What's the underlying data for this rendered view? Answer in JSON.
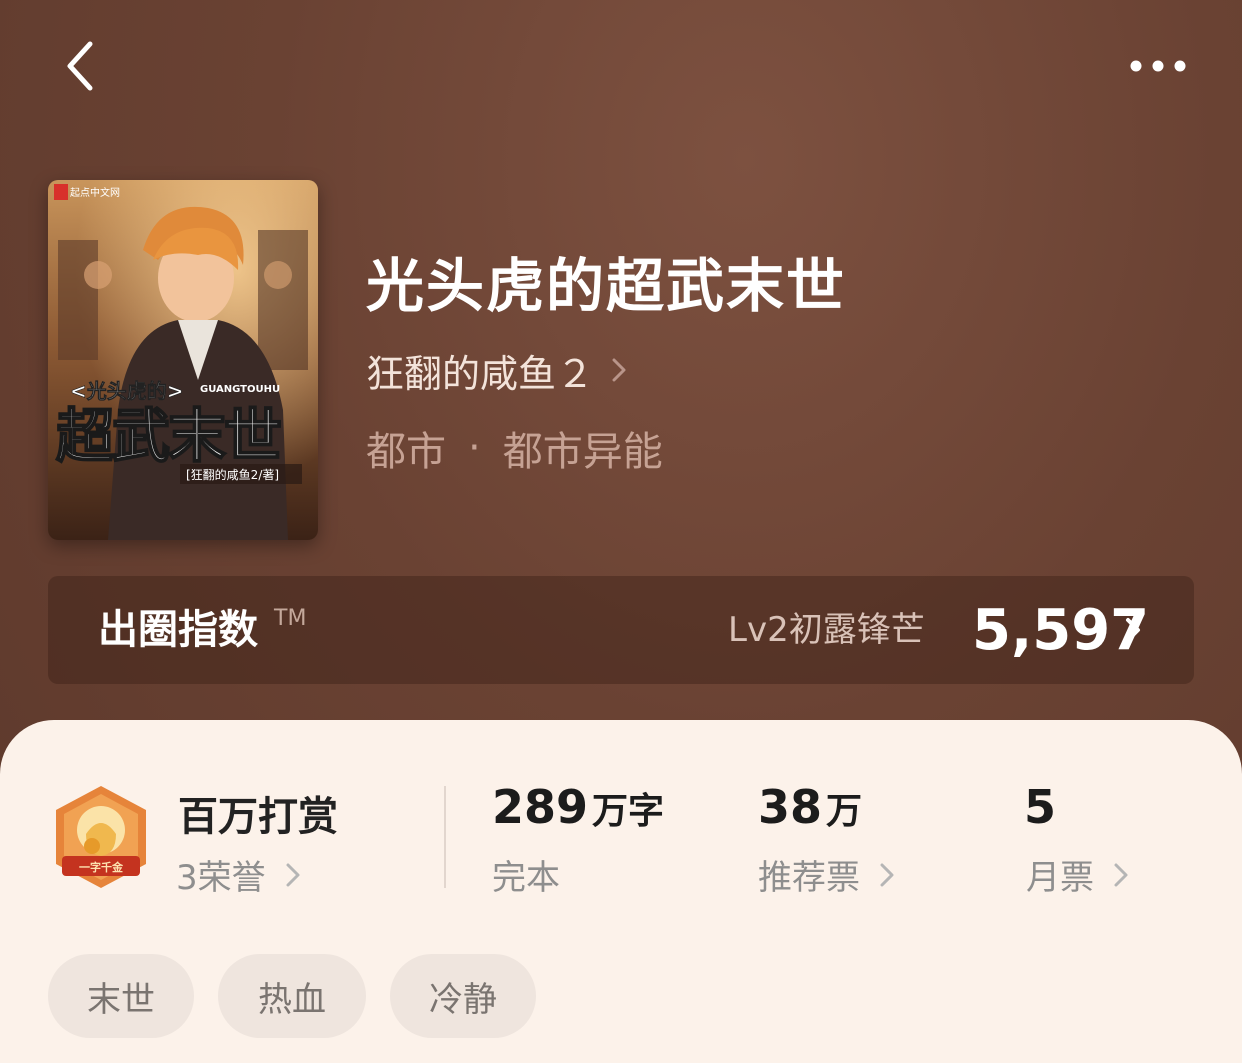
{
  "header": {
    "back_icon": "chevron-left-icon",
    "more_icon": "more-dots-icon"
  },
  "book": {
    "title": "光头虎的超武末世",
    "author": "狂翻的咸鱼２",
    "category": "都市",
    "separator": "·",
    "subcategory": "都市异能",
    "cover": {
      "publisher": "起点中文网",
      "series_small": "<光头虎的>",
      "series_en": "GUANGTOUHU",
      "cover_title": "超武末世",
      "cover_author": "[狂翻的咸鱼2/著]"
    }
  },
  "index_banner": {
    "label": "出圈指数",
    "tm": "TM",
    "level": "Lv2初露锋芒",
    "score": "5,597"
  },
  "stats": {
    "reward": {
      "title": "百万打赏",
      "sub": "3荣誉",
      "badge_text": "一字千金"
    },
    "words": {
      "value": "289",
      "unit": "万字",
      "sub": "完本"
    },
    "recommend": {
      "value": "38",
      "unit": "万",
      "sub": "推荐票"
    },
    "monthly": {
      "value": "5",
      "sub": "月票"
    }
  },
  "tags": [
    "末世",
    "热血",
    "冷静"
  ],
  "colors": {
    "header_bg": "#6a4233",
    "card_bg": "#fcf2ea",
    "tag_bg": "#efe5de",
    "badge_orange": "#e4732f",
    "badge_red": "#c23624"
  }
}
